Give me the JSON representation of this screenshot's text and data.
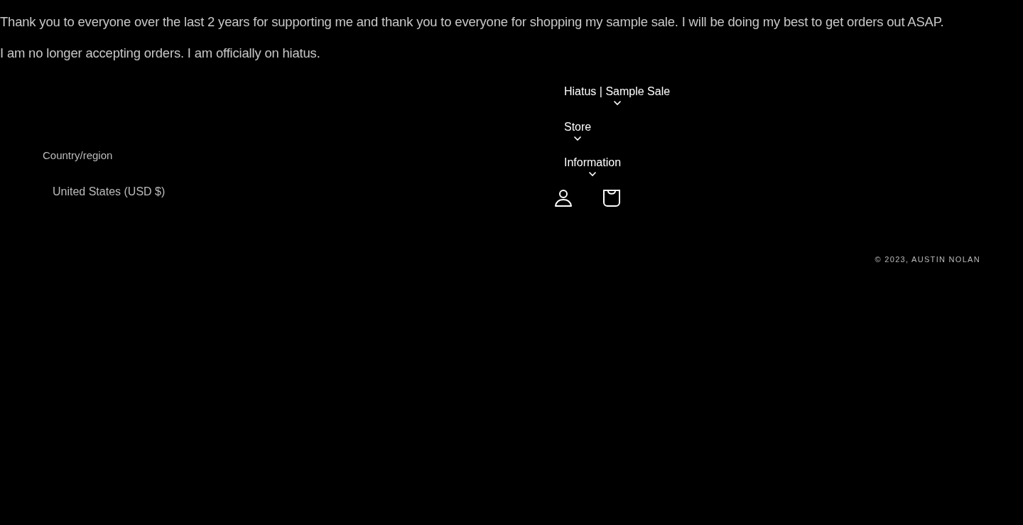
{
  "announcement": [
    "Thank you to everyone over the last 2 years for supporting me and thank you to everyone for shopping my sample sale. I will be doing my best to get orders out ASAP.",
    "I am no longer accepting orders. I am officially on hiatus."
  ],
  "localization": {
    "label": "Country/region",
    "value": "United States (USD $)"
  },
  "menu": [
    {
      "label": "Hiatus | Sample Sale",
      "expanded": false
    },
    {
      "label": "Store",
      "expanded": false
    },
    {
      "label": "Information",
      "expanded": false
    }
  ],
  "copyright": "© 2023, AUSTIN NOLAN"
}
